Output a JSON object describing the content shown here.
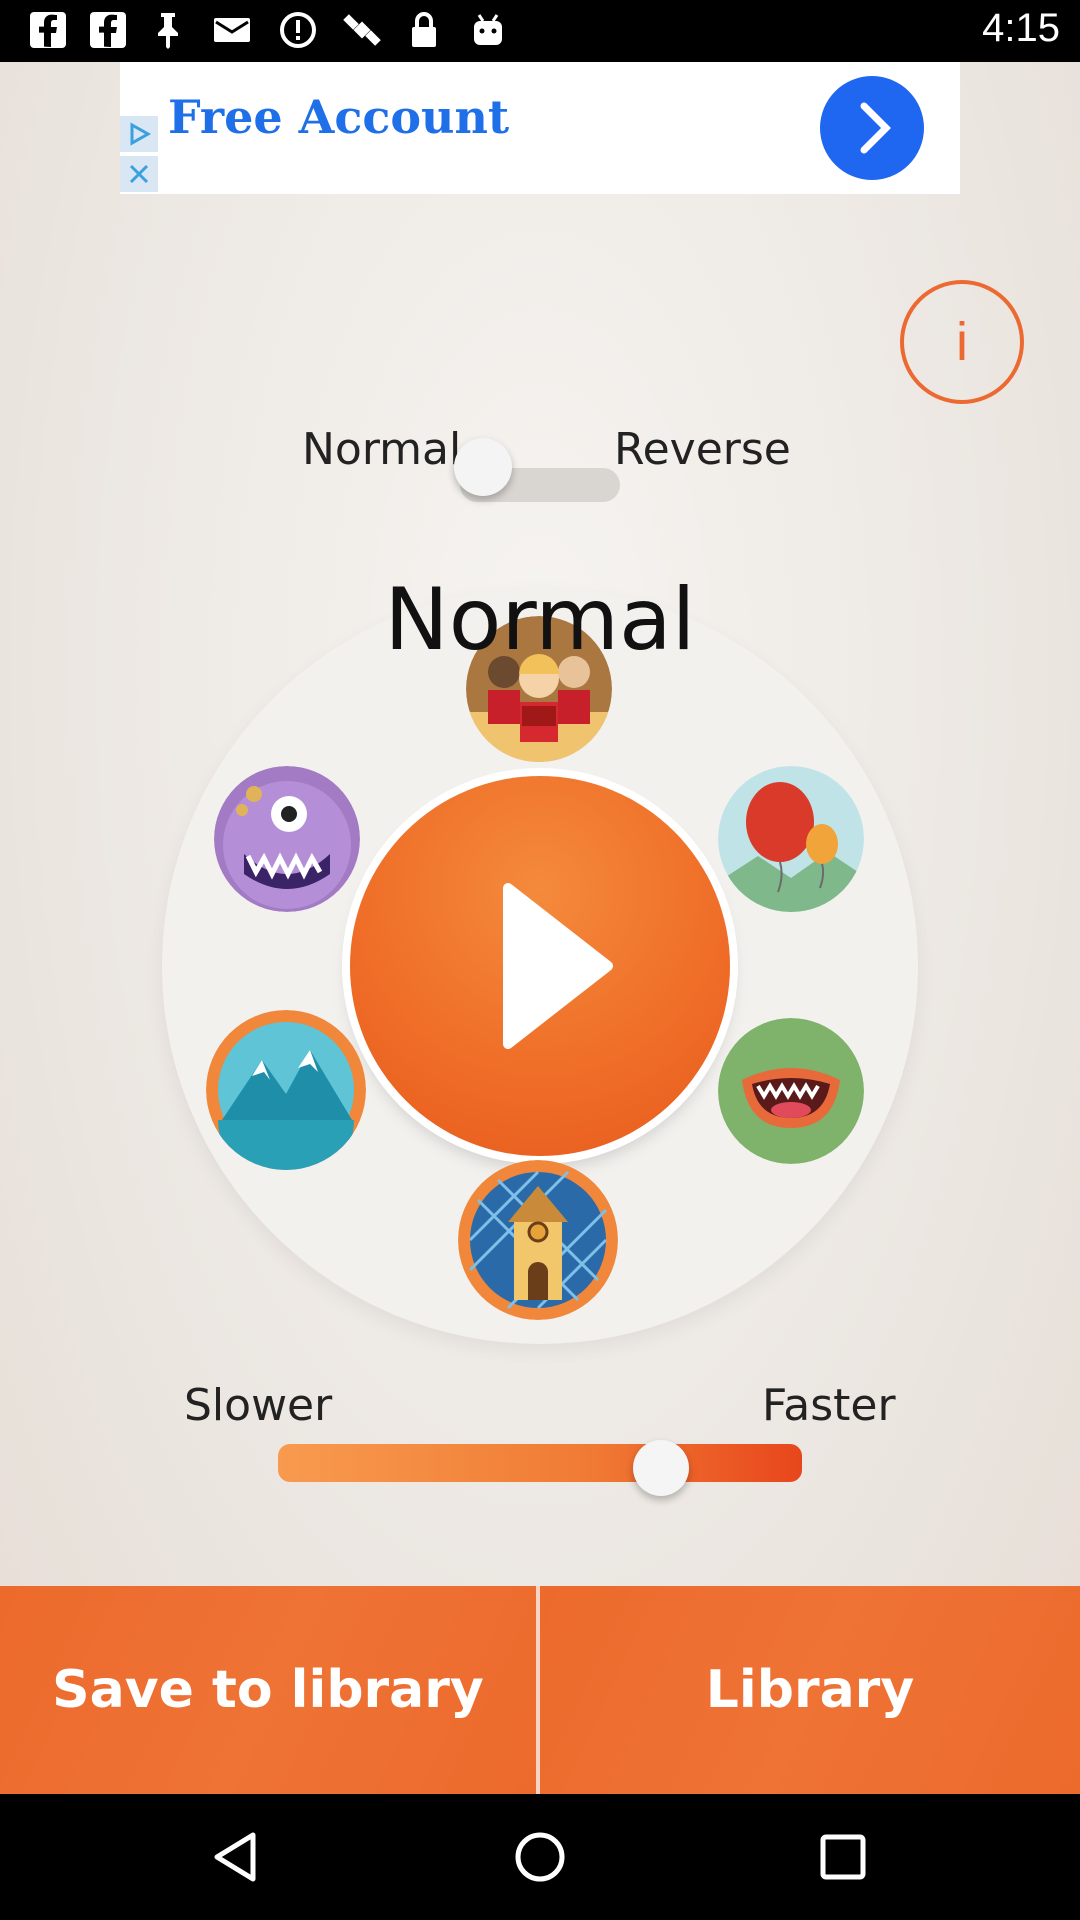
{
  "status_bar": {
    "time": "4:15",
    "icons": [
      "facebook-icon",
      "facebook-icon",
      "pin-icon",
      "mail-icon",
      "alert-icon",
      "satellite-icon",
      "lock-icon",
      "android-icon"
    ]
  },
  "ad": {
    "title": "Free Account",
    "badges": [
      "ad-choices-icon",
      "close-icon"
    ],
    "arrow_icon": "chevron-right-icon",
    "accent": "#1f66f0"
  },
  "info": {
    "label": "i"
  },
  "mode_toggle": {
    "left_label": "Normal",
    "right_label": "Reverse",
    "selected": "Normal"
  },
  "effects": {
    "current": "Normal",
    "presets": [
      "choir-preset",
      "balloon-preset",
      "mouth-preset",
      "church-preset",
      "mountain-preset",
      "monster-preset"
    ]
  },
  "speed": {
    "slower_label": "Slower",
    "faster_label": "Faster",
    "value_fraction": 0.73
  },
  "bottom": {
    "save_label": "Save to library",
    "library_label": "Library"
  },
  "colors": {
    "accent": "#ee6a2d",
    "info_ring": "#ec6a32"
  },
  "nav": {
    "icons": [
      "back-icon",
      "home-icon",
      "recents-icon"
    ]
  }
}
